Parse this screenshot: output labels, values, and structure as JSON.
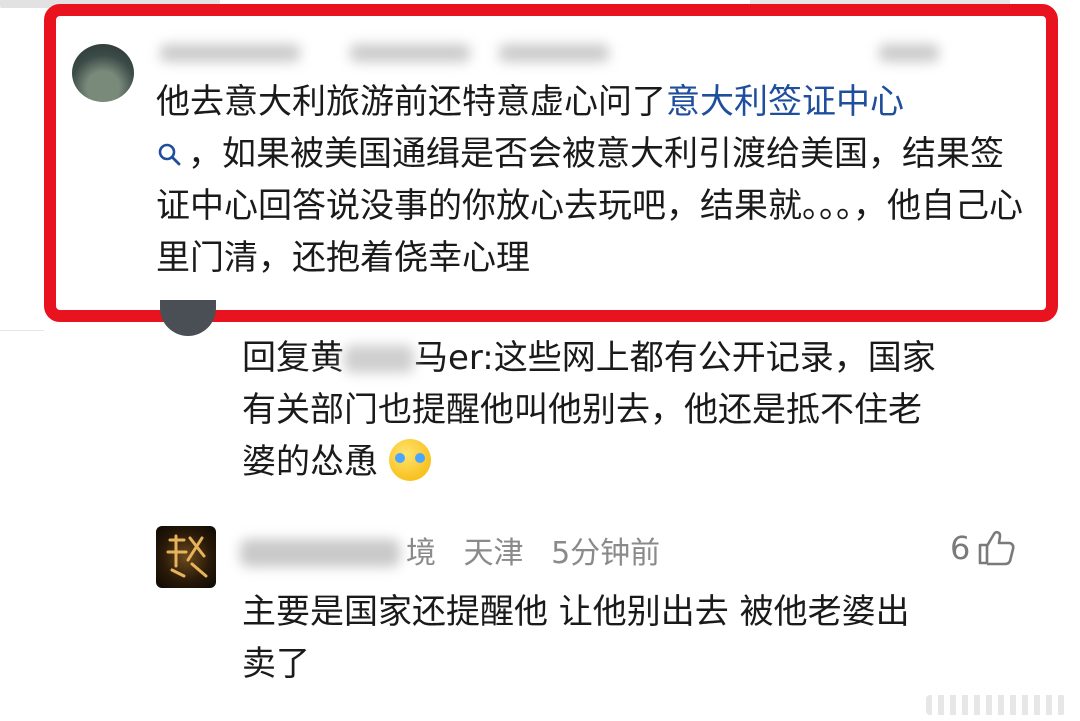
{
  "comments": [
    {
      "username": "",
      "location": "",
      "time": "",
      "likes": "",
      "body_segments": [
        {
          "text": "他去意大利旅游前还特意虚心问了",
          "style": "plain"
        },
        {
          "text": "意大利签证中心",
          "style": "link"
        },
        {
          "text": "，如果被美国通缉是否会被意大利引渡给美国，结果签证中心回答说没事的你放心去玩吧，结果就。。。，他自己心里门清，还抱着侥幸心理",
          "style": "plain"
        }
      ]
    },
    {
      "reply_prefix": "回复",
      "reply_to_visible": "黄",
      "reply_to_tail": "马er:",
      "body_lines": [
        "这些网上都有公开记录，国家",
        "有关部门也提醒他叫他别去，他还是抵不住老",
        "婆的怂恿"
      ]
    },
    {
      "username_visible": "境",
      "location": "天津",
      "time": "5分钟前",
      "likes": "6",
      "body_lines": [
        "主要是国家还提醒他 让他别出去 被他老婆出",
        "卖了"
      ]
    }
  ],
  "colors": {
    "highlight": "#e8131e",
    "link": "#1f4e9c",
    "meta": "#8a8a8a"
  },
  "icons": {
    "search": "search-icon",
    "like": "thumb-up-icon",
    "emoji": "crying-laughing-emoji"
  }
}
